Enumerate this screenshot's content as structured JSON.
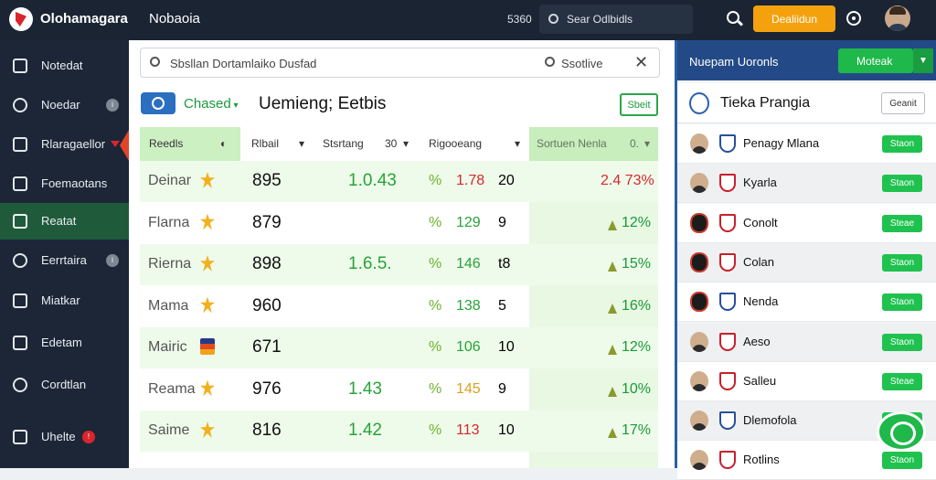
{
  "topbar": {
    "app_name": "Olohamagara",
    "nav_label": "Nobaoia",
    "counter": "5360",
    "search_placeholder": "Sear Odlbidls",
    "cta_label": "Dealiidun"
  },
  "sidebar": {
    "items": [
      {
        "label": "Notedat",
        "icon": "home-icon"
      },
      {
        "label": "Noedar",
        "icon": "search-icon",
        "badge": "i"
      },
      {
        "label": "Rlaragaellor",
        "icon": "house-icon"
      },
      {
        "label": "Foemaotans",
        "icon": "building-icon"
      },
      {
        "label": "Reatat",
        "icon": "money-icon"
      },
      {
        "label": "Eerrtaira",
        "icon": "star-icon",
        "badge": "i"
      },
      {
        "label": "Miatkar",
        "icon": "calendar-icon"
      },
      {
        "label": "Edetam",
        "icon": "stats-icon"
      },
      {
        "label": "Cordtlan",
        "icon": "support-icon"
      },
      {
        "label": "Uhelte",
        "icon": "logout-icon",
        "badge": "!"
      }
    ]
  },
  "main": {
    "search_text": "Sbsllan Dortamlaiko Dusfad",
    "filter_text": "Ssotlive",
    "filter_label": "Chased",
    "title": "Uemieng; Eetbis",
    "side_button": "Sbeit",
    "columns": [
      "Reedls",
      "Rlbail",
      "Stsrtang",
      "30",
      "Rigooeang",
      "Sortuen Nenla",
      "0."
    ],
    "rows": [
      {
        "name": "Deinar",
        "v1": "895",
        "v2": "1.0.43",
        "odds": "1.78",
        "n": "20",
        "chg": "2.4 73%",
        "highlight": false
      },
      {
        "name": "Flarna",
        "v1": "879",
        "v2": "",
        "odds": "129",
        "n": "9",
        "chg": "12%",
        "highlight": false
      },
      {
        "name": "Rierna",
        "v1": "898",
        "v2": "1.6.5.",
        "odds": "146",
        "n": "t8",
        "chg": "15%",
        "highlight": true
      },
      {
        "name": "Mama",
        "v1": "960",
        "v2": "",
        "odds": "138",
        "n": "5",
        "chg": "16%",
        "highlight": false
      },
      {
        "name": "Mairic",
        "v1": "671",
        "v2": "",
        "odds": "106",
        "n": "10",
        "chg": "12%",
        "highlight": false
      },
      {
        "name": "Reama",
        "v1": "976",
        "v2": "1.43",
        "odds": "145",
        "n": "9",
        "chg": "10%",
        "highlight": true
      },
      {
        "name": "Saime",
        "v1": "816",
        "v2": "1.42",
        "odds": "113",
        "n": "10",
        "chg": "17%",
        "highlight": true
      }
    ]
  },
  "right": {
    "header_title": "Nuepam Uoronls",
    "header_button": "Moteak",
    "sub_title": "Tieka Prangia",
    "sub_button": "Geanit",
    "players": [
      {
        "name": "Penagy Mlana",
        "button": "Staon"
      },
      {
        "name": "Kyarla",
        "button": "Staon"
      },
      {
        "name": "Conolt",
        "button": "Steae"
      },
      {
        "name": "Colan",
        "button": "Staon"
      },
      {
        "name": "Nenda",
        "button": "Staon"
      },
      {
        "name": "Aeso",
        "button": "Staon"
      },
      {
        "name": "Salleu",
        "button": "Steae"
      },
      {
        "name": "Dlemofola",
        "button": "Staon"
      },
      {
        "name": "Rotlins",
        "button": "Staon"
      }
    ]
  },
  "colors": {
    "accent_green": "#1fb84b",
    "cta_orange": "#f4a10e",
    "header_blue": "#234a86",
    "sidebar_dark": "#1c2636"
  }
}
